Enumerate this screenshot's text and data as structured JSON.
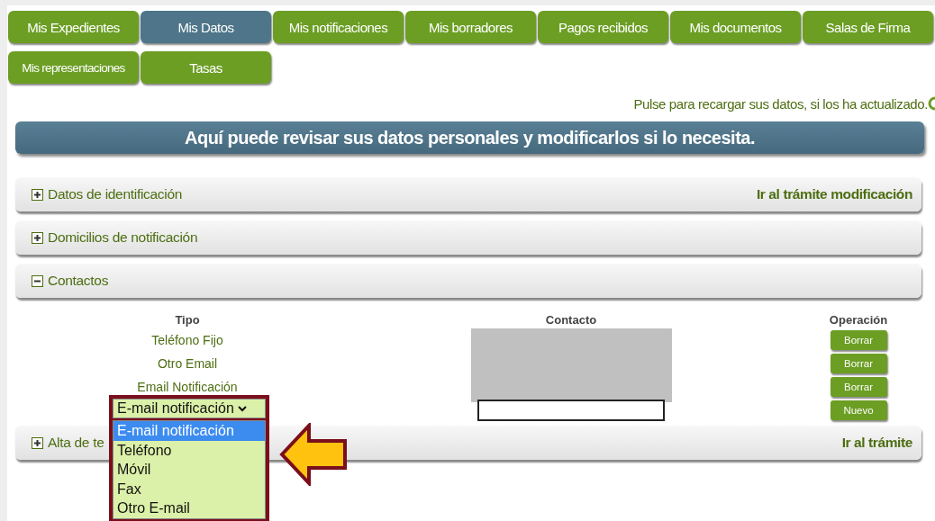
{
  "tabs": [
    {
      "label": "Mis Expedientes",
      "selected": false
    },
    {
      "label": "Mis Datos",
      "selected": true
    },
    {
      "label": "Mis notificaciones",
      "selected": false
    },
    {
      "label": "Mis borradores",
      "selected": false
    },
    {
      "label": "Pagos recibidos",
      "selected": false
    },
    {
      "label": "Mis documentos",
      "selected": false
    },
    {
      "label": "Salas de Firma",
      "selected": false
    },
    {
      "label": "Mis representaciones",
      "selected": false
    },
    {
      "label": "Tasas",
      "selected": false
    }
  ],
  "reload_text": "Pulse para recargar sus datos, si los ha actualizado.",
  "banner": "Aquí puede revisar sus datos personales y modificarlos si lo necesita.",
  "sections": [
    {
      "title": "Datos de identificación",
      "expanded": false,
      "link": "Ir al trámite modificación"
    },
    {
      "title": "Domicilios de notificación",
      "expanded": false
    },
    {
      "title": "Contactos",
      "expanded": true
    },
    {
      "title": "Alta de te",
      "expanded": false,
      "link": "Ir al trámite"
    }
  ],
  "contacts": {
    "columns": [
      "Tipo",
      "Contacto",
      "Operación"
    ],
    "rows": [
      {
        "type": "Teléfono Fijo",
        "action": "Borrar"
      },
      {
        "type": "Otro Email",
        "action": "Borrar"
      },
      {
        "type": "Email Notificación",
        "action": "Borrar"
      }
    ],
    "new_row": {
      "select": {
        "value": "E-mail notificación",
        "expanded": true,
        "options": [
          {
            "label": "E-mail notificación",
            "selected": true
          },
          {
            "label": "Teléfono",
            "selected": false
          },
          {
            "label": "Móvil",
            "selected": false
          },
          {
            "label": "Fax",
            "selected": false
          },
          {
            "label": "Otro E-mail",
            "selected": false
          }
        ]
      },
      "action": "Nuevo"
    }
  }
}
